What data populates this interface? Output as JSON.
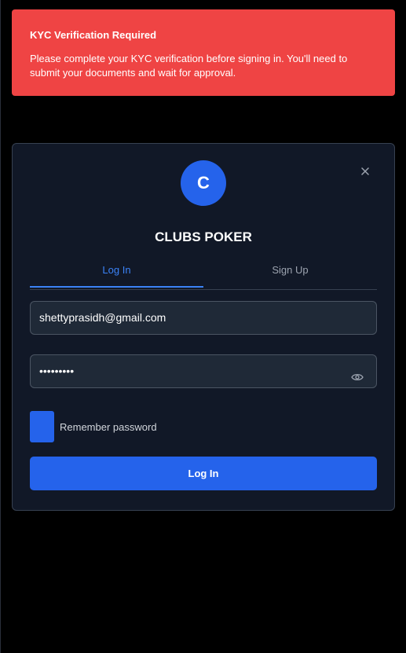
{
  "alert": {
    "title": "KYC Verification Required",
    "message": "Please complete your KYC verification before signing in. You'll need to submit your documents and wait for approval.",
    "color": "#ef4444"
  },
  "modal": {
    "avatar_letter": "C",
    "brand": "CLUBS POKER",
    "close_icon": "close-icon",
    "tabs": [
      {
        "label": "Log In",
        "active": true
      },
      {
        "label": "Sign Up",
        "active": false
      }
    ],
    "email": {
      "value": "shettyprasidh@gmail.com"
    },
    "password": {
      "masked_value": "•••••••••",
      "toggle_icon": "eye-icon"
    },
    "remember_label": "Remember password",
    "submit_label": "Log In",
    "accent_color": "#2563eb"
  }
}
